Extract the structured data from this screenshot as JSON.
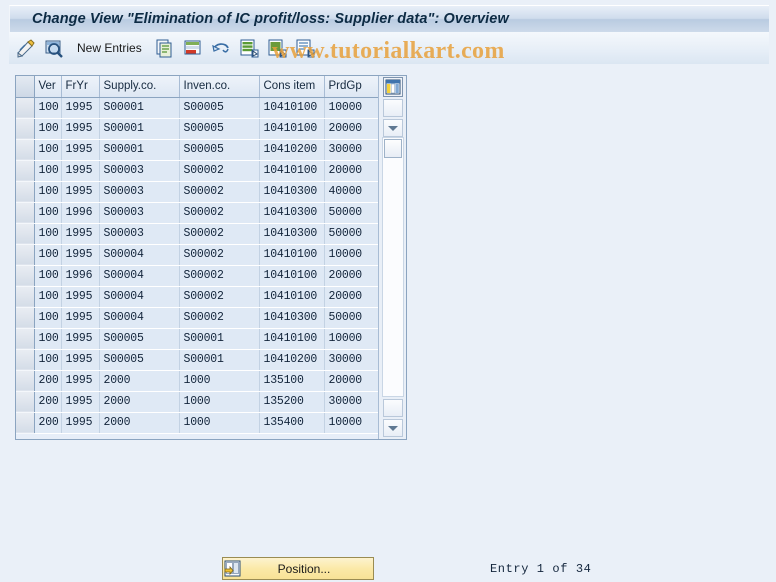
{
  "window": {
    "title": "Change View \"Elimination of IC profit/loss: Supplier data\": Overview"
  },
  "watermark": {
    "text": "www.tutorialkart.com",
    "color": "#e8a13c"
  },
  "toolbar": {
    "new_entries_label": "New Entries",
    "icons": [
      "display-change-icon",
      "search-magnifier-icon",
      "copy-icon",
      "delete-row-icon",
      "undo-icon",
      "select-all-icon",
      "deselect-all-icon",
      "details-icon"
    ]
  },
  "table": {
    "columns": [
      {
        "key": "selector",
        "label": ""
      },
      {
        "key": "ver",
        "label": "Ver"
      },
      {
        "key": "fryr",
        "label": "FrYr"
      },
      {
        "key": "supply_co",
        "label": "Supply.co."
      },
      {
        "key": "inven_co",
        "label": "Inven.co."
      },
      {
        "key": "cons_item",
        "label": "Cons item"
      },
      {
        "key": "prd_gp",
        "label": "PrdGp"
      }
    ],
    "rows": [
      {
        "ver": "100",
        "fryr": "1995",
        "supply_co": "S00001",
        "inven_co": "S00005",
        "cons_item": "10410100",
        "prd_gp": "10000"
      },
      {
        "ver": "100",
        "fryr": "1995",
        "supply_co": "S00001",
        "inven_co": "S00005",
        "cons_item": "10410100",
        "prd_gp": "20000"
      },
      {
        "ver": "100",
        "fryr": "1995",
        "supply_co": "S00001",
        "inven_co": "S00005",
        "cons_item": "10410200",
        "prd_gp": "30000"
      },
      {
        "ver": "100",
        "fryr": "1995",
        "supply_co": "S00003",
        "inven_co": "S00002",
        "cons_item": "10410100",
        "prd_gp": "20000"
      },
      {
        "ver": "100",
        "fryr": "1995",
        "supply_co": "S00003",
        "inven_co": "S00002",
        "cons_item": "10410300",
        "prd_gp": "40000"
      },
      {
        "ver": "100",
        "fryr": "1996",
        "supply_co": "S00003",
        "inven_co": "S00002",
        "cons_item": "10410300",
        "prd_gp": "50000"
      },
      {
        "ver": "100",
        "fryr": "1995",
        "supply_co": "S00003",
        "inven_co": "S00002",
        "cons_item": "10410300",
        "prd_gp": "50000"
      },
      {
        "ver": "100",
        "fryr": "1995",
        "supply_co": "S00004",
        "inven_co": "S00002",
        "cons_item": "10410100",
        "prd_gp": "10000"
      },
      {
        "ver": "100",
        "fryr": "1996",
        "supply_co": "S00004",
        "inven_co": "S00002",
        "cons_item": "10410100",
        "prd_gp": "20000"
      },
      {
        "ver": "100",
        "fryr": "1995",
        "supply_co": "S00004",
        "inven_co": "S00002",
        "cons_item": "10410100",
        "prd_gp": "20000"
      },
      {
        "ver": "100",
        "fryr": "1995",
        "supply_co": "S00004",
        "inven_co": "S00002",
        "cons_item": "10410300",
        "prd_gp": "50000"
      },
      {
        "ver": "100",
        "fryr": "1995",
        "supply_co": "S00005",
        "inven_co": "S00001",
        "cons_item": "10410100",
        "prd_gp": "10000"
      },
      {
        "ver": "100",
        "fryr": "1995",
        "supply_co": "S00005",
        "inven_co": "S00001",
        "cons_item": "10410200",
        "prd_gp": "30000"
      },
      {
        "ver": "200",
        "fryr": "1995",
        "supply_co": "2000",
        "inven_co": "1000",
        "cons_item": "135100",
        "prd_gp": "20000"
      },
      {
        "ver": "200",
        "fryr": "1995",
        "supply_co": "2000",
        "inven_co": "1000",
        "cons_item": "135200",
        "prd_gp": "30000"
      },
      {
        "ver": "200",
        "fryr": "1995",
        "supply_co": "2000",
        "inven_co": "1000",
        "cons_item": "135400",
        "prd_gp": "10000"
      }
    ]
  },
  "footer": {
    "position_button_label": "Position...",
    "entry_status": "Entry 1 of 34"
  }
}
